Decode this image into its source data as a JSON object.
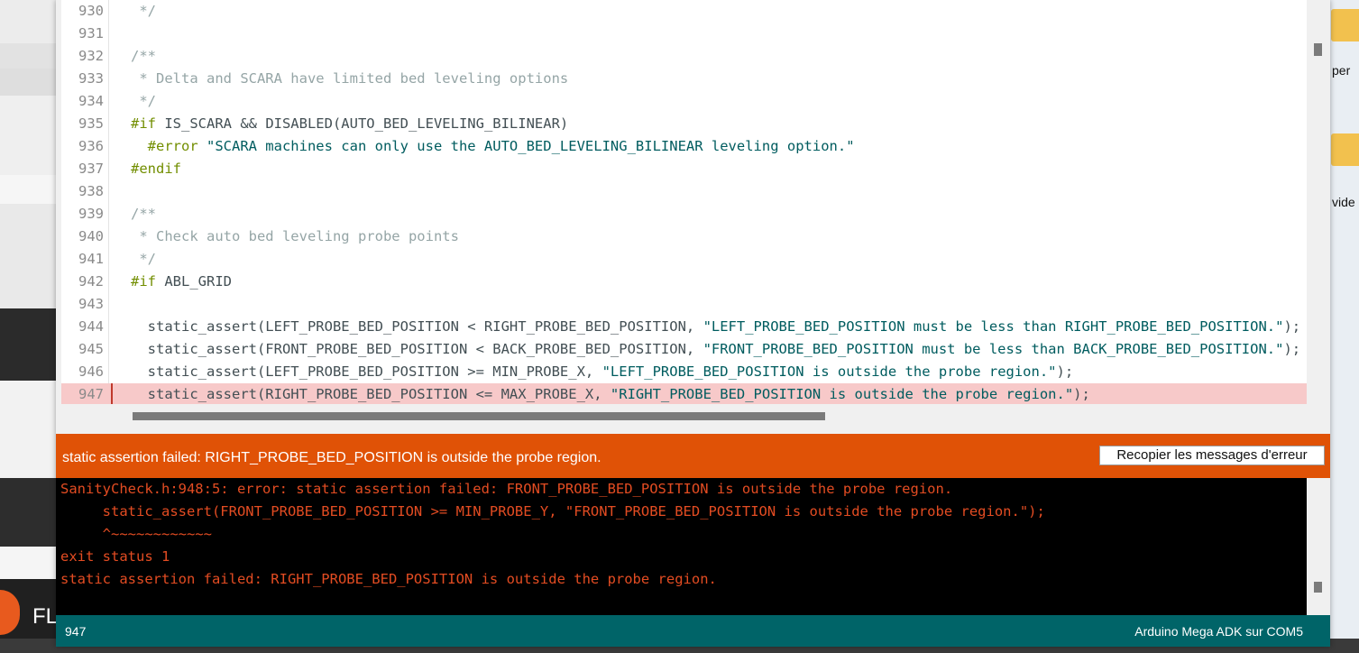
{
  "editor": {
    "lines": [
      {
        "num": "930",
        "parts": [
          {
            "t": " */",
            "c": "com"
          }
        ]
      },
      {
        "num": "931",
        "parts": []
      },
      {
        "num": "932",
        "parts": [
          {
            "t": "/**",
            "c": "com"
          }
        ]
      },
      {
        "num": "933",
        "parts": [
          {
            "t": " * Delta and SCARA have limited bed leveling options",
            "c": "com"
          }
        ]
      },
      {
        "num": "934",
        "parts": [
          {
            "t": " */",
            "c": "com"
          }
        ]
      },
      {
        "num": "935",
        "parts": [
          {
            "t": "#if",
            "c": "kw"
          },
          {
            "t": " IS_SCARA && DISABLED(AUTO_BED_LEVELING_BILINEAR)",
            "c": "plain"
          }
        ]
      },
      {
        "num": "936",
        "parts": [
          {
            "t": "  #error",
            "c": "kw"
          },
          {
            "t": " \"SCARA machines can only use the AUTO_BED_LEVELING_BILINEAR leveling option.\"",
            "c": "str"
          }
        ]
      },
      {
        "num": "937",
        "parts": [
          {
            "t": "#endif",
            "c": "kw"
          }
        ]
      },
      {
        "num": "938",
        "parts": []
      },
      {
        "num": "939",
        "parts": [
          {
            "t": "/**",
            "c": "com"
          }
        ]
      },
      {
        "num": "940",
        "parts": [
          {
            "t": " * Check auto bed leveling probe points",
            "c": "com"
          }
        ]
      },
      {
        "num": "941",
        "parts": [
          {
            "t": " */",
            "c": "com"
          }
        ]
      },
      {
        "num": "942",
        "parts": [
          {
            "t": "#if",
            "c": "kw"
          },
          {
            "t": " ABL_GRID",
            "c": "plain"
          }
        ]
      },
      {
        "num": "943",
        "parts": []
      },
      {
        "num": "944",
        "parts": [
          {
            "t": "  static_assert(LEFT_PROBE_BED_POSITION < RIGHT_PROBE_BED_POSITION, ",
            "c": "plain"
          },
          {
            "t": "\"LEFT_PROBE_BED_POSITION must be less than RIGHT_PROBE_BED_POSITION.\"",
            "c": "str"
          },
          {
            "t": ");",
            "c": "plain"
          }
        ]
      },
      {
        "num": "945",
        "parts": [
          {
            "t": "  static_assert(FRONT_PROBE_BED_POSITION < BACK_PROBE_BED_POSITION, ",
            "c": "plain"
          },
          {
            "t": "\"FRONT_PROBE_BED_POSITION must be less than BACK_PROBE_BED_POSITION.\"",
            "c": "str"
          },
          {
            "t": ");",
            "c": "plain"
          }
        ]
      },
      {
        "num": "946",
        "parts": [
          {
            "t": "  static_assert(LEFT_PROBE_BED_POSITION >= MIN_PROBE_X, ",
            "c": "plain"
          },
          {
            "t": "\"LEFT_PROBE_BED_POSITION is outside the probe region.\"",
            "c": "str"
          },
          {
            "t": ");",
            "c": "plain"
          }
        ]
      },
      {
        "num": "947",
        "parts": [
          {
            "t": "  static_assert(RIGHT_PROBE_BED_POSITION <= MAX_PROBE_X, ",
            "c": "plain"
          },
          {
            "t": "\"RIGHT_PROBE_BED_POSITION is outside the probe region.\"",
            "c": "str"
          },
          {
            "t": ");",
            "c": "plain"
          }
        ],
        "highlight": true
      }
    ]
  },
  "error_bar": {
    "message": "static assertion failed: RIGHT_PROBE_BED_POSITION is outside the probe region.",
    "copy_button_label": "Recopier les messages d'erreur"
  },
  "console": {
    "lines": [
      "SanityCheck.h:948:5: error: static assertion failed: FRONT_PROBE_BED_POSITION is outside the probe region.",
      "     static_assert(FRONT_PROBE_BED_POSITION >= MIN_PROBE_Y, \"FRONT_PROBE_BED_POSITION is outside the probe region.\");",
      "     ^~~~~~~~~~~~~",
      "exit status 1",
      "static assertion failed: RIGHT_PROBE_BED_POSITION is outside the probe region."
    ]
  },
  "status_bar": {
    "line_number": "947",
    "board_port": "Arduino Mega ADK sur COM5"
  },
  "desktop": {
    "label_1": "per",
    "label_2": "vide",
    "taskbar_text": "FL"
  },
  "colors": {
    "error_orange": "#e05206",
    "status_teal": "#006468",
    "console_text": "#e34c22",
    "keyword": "#728e00",
    "string": "#005c5f",
    "comment": "#95a5a6",
    "highlight_line": "#f7c9c9"
  }
}
